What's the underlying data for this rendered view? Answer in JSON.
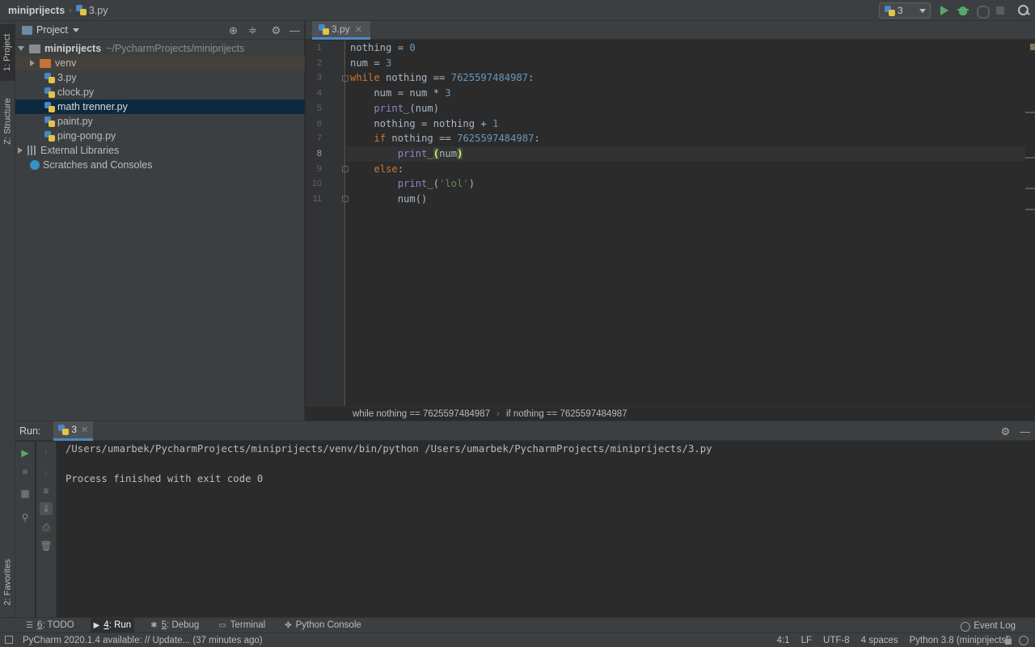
{
  "nav": {
    "project": "miniprijects",
    "file": "3.py"
  },
  "toolbar": {
    "run_config": "3"
  },
  "left_strip": {
    "project_tab": "1: Project",
    "structure_tab": "Z: Structure",
    "favorites_tab": "2: Favorites"
  },
  "project_panel": {
    "title": "Project",
    "root_name": "miniprijects",
    "root_path": "~/PycharmProjects/miniprijects",
    "items": [
      {
        "label": "venv"
      },
      {
        "label": "3.py"
      },
      {
        "label": "clock.py"
      },
      {
        "label": "math trenner.py"
      },
      {
        "label": "paint.py"
      },
      {
        "label": "ping-pong.py"
      }
    ],
    "external_libraries": "External Libraries",
    "scratches": "Scratches and Consoles"
  },
  "editor": {
    "tab": "3.py",
    "line_numbers": [
      "1",
      "2",
      "3",
      "4",
      "5",
      "6",
      "7",
      "8",
      "9",
      "10",
      "11"
    ],
    "current_line": 8,
    "code": {
      "l1": {
        "a": "nothing = ",
        "b": "0"
      },
      "l2": {
        "a": "num = ",
        "b": "3"
      },
      "l3": {
        "kw": "while",
        "a": " nothing == ",
        "b": "7625597484987",
        "c": ":"
      },
      "l4": {
        "a": "    num = num * ",
        "b": "3"
      },
      "l5": {
        "fn": "print",
        "a": "(num)"
      },
      "l6": {
        "a": "    nothing = nothing + ",
        "b": "1"
      },
      "l7": {
        "kw": "if",
        "a": " nothing == ",
        "b": "7625597484987",
        "c": ":"
      },
      "l8": {
        "fn": "print",
        "o": "(",
        "a": "num",
        "cl": ")"
      },
      "l9": {
        "kw": "else",
        "a": ":"
      },
      "l10": {
        "fn": "print",
        "a": "(",
        "s": "'lol'",
        "c": ")"
      },
      "l11": {
        "a": "num()"
      }
    },
    "breadcrumbs": [
      "while nothing == 7625597484987",
      "if nothing == 7625597484987"
    ]
  },
  "run": {
    "label": "Run:",
    "tab": "3",
    "lines": [
      "/Users/umarbek/PycharmProjects/miniprijects/venv/bin/python /Users/umarbek/PycharmProjects/miniprijects/3.py",
      "Process finished with exit code 0"
    ]
  },
  "bottom_tabs": {
    "todo_num": "6",
    "todo": ": TODO",
    "run_num": "4",
    "run": ": Run",
    "debug_num": "5",
    "debug": ": Debug",
    "terminal": "Terminal",
    "python_console": "Python Console",
    "event_log": "Event Log"
  },
  "status": {
    "message": "PyCharm 2020.1.4 available: // Update... (37 minutes ago)",
    "position": "4:1",
    "line_sep": "LF",
    "encoding": "UTF-8",
    "indent": "4 spaces",
    "interpreter": "Python 3.8 (miniprijects)"
  },
  "colors": {
    "keyword": "#cc7832",
    "number": "#6897bb",
    "builtin": "#8888c6",
    "string": "#6a8759",
    "run_green": "#59a869",
    "accent": "#4a88c7"
  }
}
